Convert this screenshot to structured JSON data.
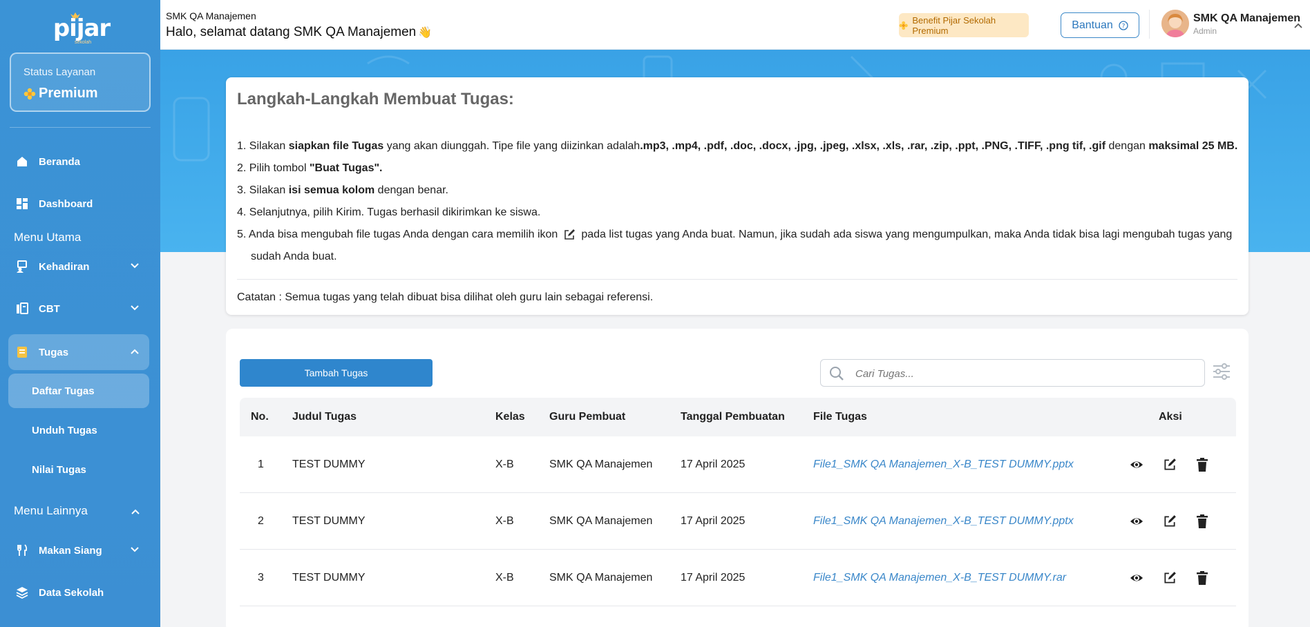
{
  "sidebar": {
    "logo": "pijar",
    "logo_sub": "sekolah",
    "status_label": "Status Layanan",
    "status_value": "Premium",
    "items": {
      "beranda": "Beranda",
      "dashboard": "Dashboard",
      "menu_utama": "Menu Utama",
      "kehadiran": "Kehadiran",
      "cbt": "CBT",
      "tugas": "Tugas",
      "daftar_tugas": "Daftar Tugas",
      "unduh_tugas": "Unduh Tugas",
      "nilai_tugas": "Nilai Tugas",
      "menu_lainnya": "Menu Lainnya",
      "makan_siang": "Makan Siang",
      "data_sekolah": "Data Sekolah"
    }
  },
  "header": {
    "school": "SMK QA Manajemen",
    "greeting": "Halo, selamat datang SMK QA Manajemen",
    "greeting_emoji": "👋",
    "benefit": "Benefit Pijar Sekolah Premium",
    "help": "Bantuan",
    "user_name": "SMK QA Manajemen",
    "user_role": "Admin"
  },
  "steps": {
    "title": "Langkah-Langkah Membuat Tugas:",
    "s1": {
      "n": "1.",
      "a": "Silakan ",
      "b1": "siapkan file Tugas",
      "c": " yang akan diunggah. Tipe file yang diizinkan adalah",
      "b2": ".mp3, .mp4, .pdf, .doc, .docx, .jpg, .jpeg, .xlsx, .xls, .rar, .zip, .ppt, .PNG, .TIFF, .png tif, .gif",
      "d": " dengan ",
      "b3": "maksimal 25 MB."
    },
    "s2": {
      "n": "2.",
      "a": "Pilih tombol ",
      "b1": "\"Buat Tugas\"."
    },
    "s3": {
      "n": "3.",
      "a": "Silakan ",
      "b1": "isi semua kolom",
      "c": " dengan benar."
    },
    "s4": {
      "n": "4.",
      "a": "Selanjutnya, pilih Kirim. Tugas berhasil dikirimkan ke siswa."
    },
    "s5": {
      "n": "5.",
      "a": "Anda bisa mengubah file tugas Anda dengan cara memilih ikon",
      "c": "pada list tugas yang Anda buat. Namun, jika sudah ada siswa yang mengumpulkan, maka Anda tidak bisa lagi mengubah tugas yang sudah Anda buat."
    },
    "note": "Catatan : Semua tugas yang telah dibuat bisa dilihat oleh guru lain sebagai referensi."
  },
  "table": {
    "add_button": "Tambah Tugas",
    "search_placeholder": "Cari Tugas...",
    "headers": {
      "no": "No.",
      "judul": "Judul Tugas",
      "kelas": "Kelas",
      "guru": "Guru Pembuat",
      "tanggal": "Tanggal Pembuatan",
      "file": "File Tugas",
      "aksi": "Aksi"
    },
    "rows": [
      {
        "no": "1",
        "judul": "TEST DUMMY",
        "kelas": "X-B",
        "guru": "SMK QA Manajemen",
        "tanggal": "17 April 2025",
        "file": "File1_SMK QA Manajemen_X-B_TEST DUMMY.pptx"
      },
      {
        "no": "2",
        "judul": "TEST DUMMY",
        "kelas": "X-B",
        "guru": "SMK QA Manajemen",
        "tanggal": "17 April 2025",
        "file": "File1_SMK QA Manajemen_X-B_TEST DUMMY.pptx"
      },
      {
        "no": "3",
        "judul": "TEST DUMMY",
        "kelas": "X-B",
        "guru": "SMK QA Manajemen",
        "tanggal": "17 April 2025",
        "file": "File1_SMK QA Manajemen_X-B_TEST DUMMY.rar"
      }
    ]
  },
  "icons": {
    "view": "eye-icon",
    "edit": "edit-icon",
    "delete": "trash-icon",
    "search": "search-icon",
    "filter": "filter-icon"
  },
  "colors": {
    "sidebar": "#3b93d6",
    "accent": "#2f86cd",
    "link": "#3a87c9",
    "benefit_bg": "#fde8c4"
  }
}
